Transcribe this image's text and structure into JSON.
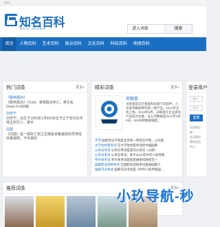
{
  "topbar": {
    "text": "服务到"
  },
  "header": {
    "logo_title": "知名百科",
    "logo_sub": "WELL-KNOWN",
    "search_option": "进入词条",
    "search_button": "搜索"
  },
  "nav": {
    "items": [
      "首页",
      "人物百科",
      "艺术百科",
      "商业百科",
      "文化百科",
      "科技百科",
      "地理百科"
    ]
  },
  "hot": {
    "title": "热门词条",
    "more": "更多»",
    "items": [
      {
        "title": "《致命弱点》",
        "desc": "《致命弱点》（Cold，食物弱点死亡。英文名：Dead To A旧版"
      },
      {
        "title": "刘宇宁",
        "desc": "刘宇宁，出生于1990年1月8日出生于辽宁省丹东市地主的艺人、歌手"
      },
      {
        "title": "白隐",
        "desc": "《白隐》是一部由丁安之生娱投资鲁旗资的凭恃性风格视频，不仅真的"
      }
    ]
  },
  "featured": {
    "title": "精彩词条",
    "more": "更多»",
    "main_title": "天眼查",
    "main_desc": "天眼查是北京金堤科技旗下的软件，人员查询数据库的第一款产品，2014年正式上线，2016年8月，天眼查在企业查询行业成为主要，该公司数据是2012年3月8日，500多种数据维度。",
    "rows": [
      {
        "cat": "学节",
        "text": "国际音乐学院是北京的一所音乐学院，公司成"
      },
      {
        "cat": "大学生村官考试",
        "text": "在大学生村官考试的中国国家"
      },
      {
        "cat": "公务员考试",
        "text": "公务员考试是成为公务员（公职）"
      },
      {
        "cat": "公务员考试",
        "text": "公务员考试，并于2012年中华人民共和"
      },
      {
        "cat": "专升本考试",
        "text": "专升本考试是指普通本科院校在一"
      },
      {
        "cat": "国家职业资格考试",
        "text": "全国职业资格考试是由国家人"
      },
      {
        "cat": "国家司法考试",
        "text": "国家司法考试是《中华人民共和国..."
      }
    ]
  },
  "login": {
    "title": "登录用户",
    "username_placeholder": "用户",
    "password_placeholder": "密码",
    "button": "登录",
    "links": [
      "还没有注册",
      "忘记密码",
      "我的会员中心"
    ]
  },
  "recommend": {
    "title": "推荐词条",
    "more": "更多»"
  },
  "watermark": {
    "text": "小玖导航-秒"
  }
}
